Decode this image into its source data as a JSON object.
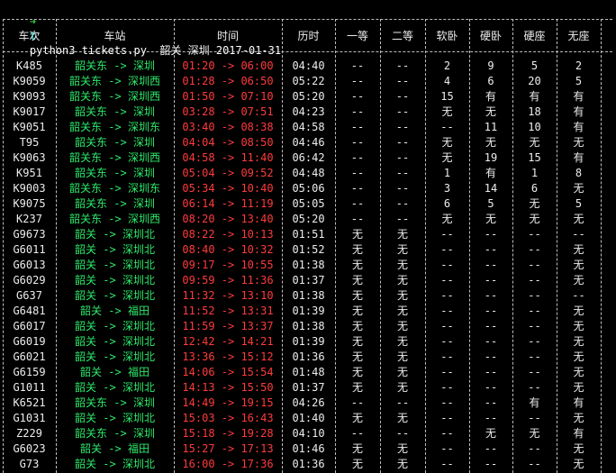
{
  "terminal": {
    "prompt_symbol": "➜",
    "prompt_dir": "t",
    "command": "python3 tickets.py  韶关 深圳 2017-01-31"
  },
  "colors": {
    "station": "#2ee86a",
    "time": "#ff3b3b",
    "text": "#ededed",
    "background": "#000000"
  },
  "headers": [
    "车次",
    "车站",
    "时间",
    "历时",
    "一等",
    "二等",
    "软卧",
    "硬卧",
    "硬座",
    "无座"
  ],
  "trains": [
    {
      "train": "K485",
      "from": "韶关东",
      "to": "深圳",
      "dep": "01:20",
      "arr": "06:00",
      "dur": "04:40",
      "first": "--",
      "second": "--",
      "soft": "2",
      "hard_sleeper": "9",
      "hard_seat": "5",
      "no_seat": "2"
    },
    {
      "train": "K9059",
      "from": "韶关东",
      "to": "深圳西",
      "dep": "01:28",
      "arr": "06:50",
      "dur": "05:22",
      "first": "--",
      "second": "--",
      "soft": "4",
      "hard_sleeper": "6",
      "hard_seat": "20",
      "no_seat": "5"
    },
    {
      "train": "K9093",
      "from": "韶关东",
      "to": "深圳西",
      "dep": "01:50",
      "arr": "07:10",
      "dur": "05:20",
      "first": "--",
      "second": "--",
      "soft": "15",
      "hard_sleeper": "有",
      "hard_seat": "有",
      "no_seat": "有"
    },
    {
      "train": "K9017",
      "from": "韶关东",
      "to": "深圳",
      "dep": "03:28",
      "arr": "07:51",
      "dur": "04:23",
      "first": "--",
      "second": "--",
      "soft": "无",
      "hard_sleeper": "无",
      "hard_seat": "18",
      "no_seat": "有"
    },
    {
      "train": "K9051",
      "from": "韶关东",
      "to": "深圳东",
      "dep": "03:40",
      "arr": "08:38",
      "dur": "04:58",
      "first": "--",
      "second": "--",
      "soft": "--",
      "hard_sleeper": "11",
      "hard_seat": "10",
      "no_seat": "有"
    },
    {
      "train": "T95",
      "from": "韶关东",
      "to": "深圳",
      "dep": "04:04",
      "arr": "08:50",
      "dur": "04:46",
      "first": "--",
      "second": "--",
      "soft": "无",
      "hard_sleeper": "无",
      "hard_seat": "无",
      "no_seat": "无"
    },
    {
      "train": "K9063",
      "from": "韶关东",
      "to": "深圳西",
      "dep": "04:58",
      "arr": "11:40",
      "dur": "06:42",
      "first": "--",
      "second": "--",
      "soft": "无",
      "hard_sleeper": "19",
      "hard_seat": "15",
      "no_seat": "有"
    },
    {
      "train": "K951",
      "from": "韶关东",
      "to": "深圳",
      "dep": "05:04",
      "arr": "09:52",
      "dur": "04:48",
      "first": "--",
      "second": "--",
      "soft": "1",
      "hard_sleeper": "有",
      "hard_seat": "1",
      "no_seat": "8"
    },
    {
      "train": "K9003",
      "from": "韶关东",
      "to": "深圳东",
      "dep": "05:34",
      "arr": "10:40",
      "dur": "05:06",
      "first": "--",
      "second": "--",
      "soft": "3",
      "hard_sleeper": "14",
      "hard_seat": "6",
      "no_seat": "无"
    },
    {
      "train": "K9075",
      "from": "韶关东",
      "to": "深圳",
      "dep": "06:14",
      "arr": "11:19",
      "dur": "05:05",
      "first": "--",
      "second": "--",
      "soft": "6",
      "hard_sleeper": "5",
      "hard_seat": "无",
      "no_seat": "5"
    },
    {
      "train": "K237",
      "from": "韶关东",
      "to": "深圳西",
      "dep": "08:20",
      "arr": "13:40",
      "dur": "05:20",
      "first": "--",
      "second": "--",
      "soft": "无",
      "hard_sleeper": "无",
      "hard_seat": "无",
      "no_seat": "无"
    },
    {
      "train": "G9673",
      "from": "韶关",
      "to": "深圳北",
      "dep": "08:22",
      "arr": "10:13",
      "dur": "01:51",
      "first": "无",
      "second": "无",
      "soft": "--",
      "hard_sleeper": "--",
      "hard_seat": "--",
      "no_seat": "--"
    },
    {
      "train": "G6011",
      "from": "韶关",
      "to": "深圳北",
      "dep": "08:40",
      "arr": "10:32",
      "dur": "01:52",
      "first": "无",
      "second": "无",
      "soft": "--",
      "hard_sleeper": "--",
      "hard_seat": "--",
      "no_seat": "无"
    },
    {
      "train": "G6013",
      "from": "韶关",
      "to": "深圳北",
      "dep": "09:17",
      "arr": "10:55",
      "dur": "01:38",
      "first": "无",
      "second": "无",
      "soft": "--",
      "hard_sleeper": "--",
      "hard_seat": "--",
      "no_seat": "无"
    },
    {
      "train": "G6029",
      "from": "韶关",
      "to": "深圳北",
      "dep": "09:59",
      "arr": "11:36",
      "dur": "01:37",
      "first": "无",
      "second": "无",
      "soft": "--",
      "hard_sleeper": "--",
      "hard_seat": "--",
      "no_seat": "无"
    },
    {
      "train": "G637",
      "from": "韶关",
      "to": "深圳北",
      "dep": "11:32",
      "arr": "13:10",
      "dur": "01:38",
      "first": "无",
      "second": "无",
      "soft": "--",
      "hard_sleeper": "--",
      "hard_seat": "--",
      "no_seat": "--"
    },
    {
      "train": "G6481",
      "from": "韶关",
      "to": "福田",
      "dep": "11:52",
      "arr": "13:31",
      "dur": "01:39",
      "first": "无",
      "second": "无",
      "soft": "--",
      "hard_sleeper": "--",
      "hard_seat": "--",
      "no_seat": "无"
    },
    {
      "train": "G6017",
      "from": "韶关",
      "to": "深圳北",
      "dep": "11:59",
      "arr": "13:37",
      "dur": "01:38",
      "first": "无",
      "second": "无",
      "soft": "--",
      "hard_sleeper": "--",
      "hard_seat": "--",
      "no_seat": "无"
    },
    {
      "train": "G6019",
      "from": "韶关",
      "to": "深圳北",
      "dep": "12:42",
      "arr": "14:21",
      "dur": "01:39",
      "first": "无",
      "second": "无",
      "soft": "--",
      "hard_sleeper": "--",
      "hard_seat": "--",
      "no_seat": "无"
    },
    {
      "train": "G6021",
      "from": "韶关",
      "to": "深圳北",
      "dep": "13:36",
      "arr": "15:12",
      "dur": "01:36",
      "first": "无",
      "second": "无",
      "soft": "--",
      "hard_sleeper": "--",
      "hard_seat": "--",
      "no_seat": "无"
    },
    {
      "train": "G6159",
      "from": "韶关",
      "to": "福田",
      "dep": "14:06",
      "arr": "15:54",
      "dur": "01:48",
      "first": "无",
      "second": "无",
      "soft": "--",
      "hard_sleeper": "--",
      "hard_seat": "--",
      "no_seat": "无"
    },
    {
      "train": "G1011",
      "from": "韶关",
      "to": "深圳北",
      "dep": "14:13",
      "arr": "15:50",
      "dur": "01:37",
      "first": "无",
      "second": "无",
      "soft": "--",
      "hard_sleeper": "--",
      "hard_seat": "--",
      "no_seat": "无"
    },
    {
      "train": "K6521",
      "from": "韶关东",
      "to": "深圳",
      "dep": "14:49",
      "arr": "19:15",
      "dur": "04:26",
      "first": "--",
      "second": "--",
      "soft": "--",
      "hard_sleeper": "--",
      "hard_seat": "有",
      "no_seat": "有"
    },
    {
      "train": "G1031",
      "from": "韶关",
      "to": "深圳北",
      "dep": "15:03",
      "arr": "16:43",
      "dur": "01:40",
      "first": "无",
      "second": "无",
      "soft": "--",
      "hard_sleeper": "--",
      "hard_seat": "--",
      "no_seat": "无"
    },
    {
      "train": "Z229",
      "from": "韶关东",
      "to": "深圳",
      "dep": "15:18",
      "arr": "19:28",
      "dur": "04:10",
      "first": "--",
      "second": "--",
      "soft": "--",
      "hard_sleeper": "无",
      "hard_seat": "无",
      "no_seat": "有"
    },
    {
      "train": "G6023",
      "from": "韶关",
      "to": "福田",
      "dep": "15:27",
      "arr": "17:13",
      "dur": "01:46",
      "first": "无",
      "second": "无",
      "soft": "--",
      "hard_sleeper": "--",
      "hard_seat": "--",
      "no_seat": "无"
    },
    {
      "train": "G73",
      "from": "韶关",
      "to": "深圳北",
      "dep": "16:00",
      "arr": "17:36",
      "dur": "01:36",
      "first": "无",
      "second": "无",
      "soft": "--",
      "hard_sleeper": "--",
      "hard_seat": "--",
      "no_seat": "无"
    }
  ]
}
